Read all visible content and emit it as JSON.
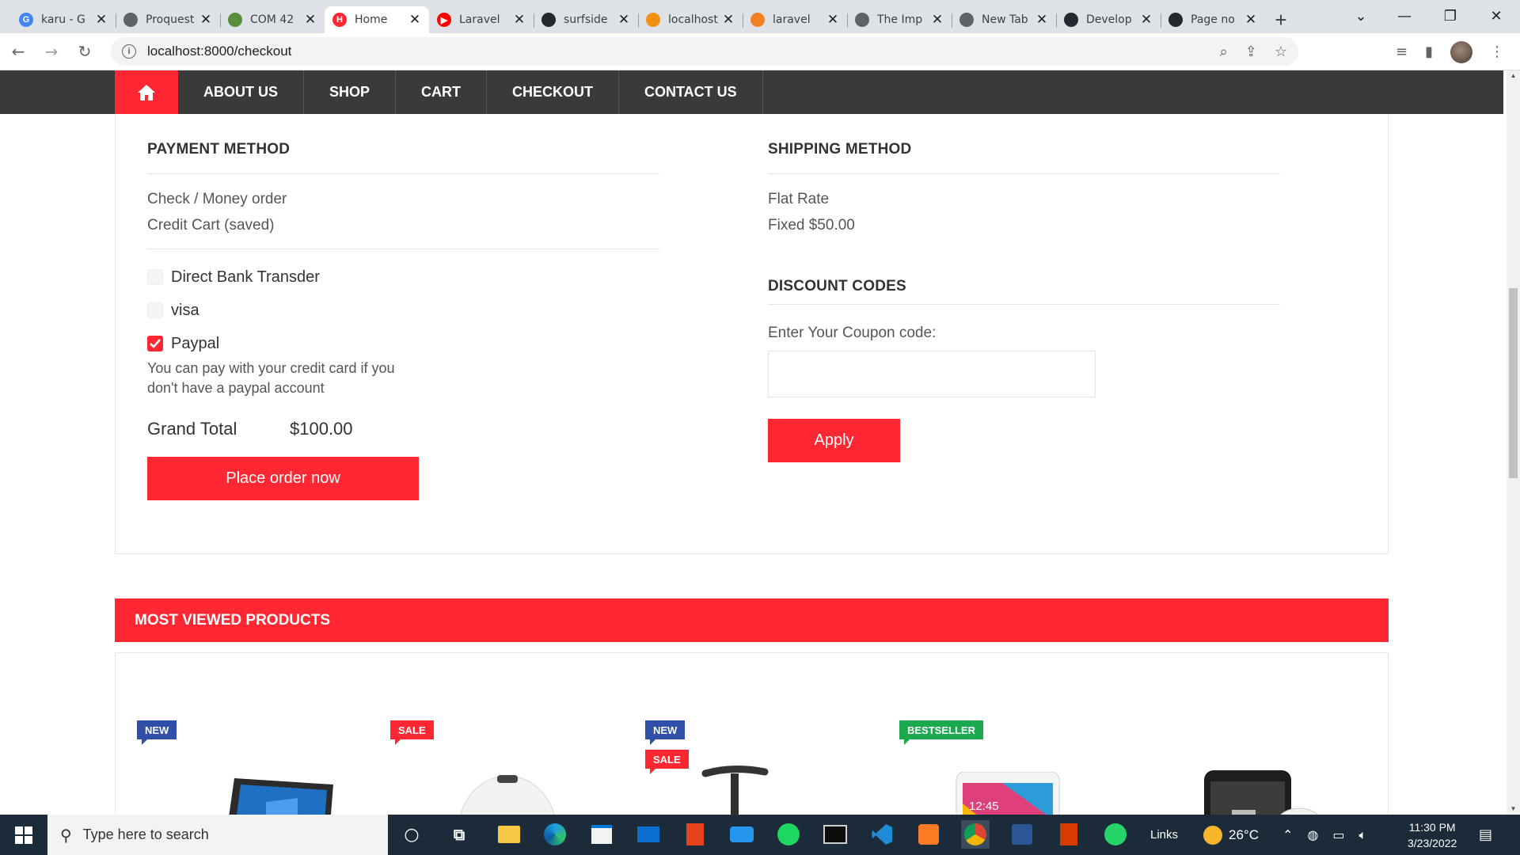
{
  "browser": {
    "tabs": [
      {
        "title": "karu - G",
        "fav_color": "#4285f4",
        "fav_glyph": "G",
        "active": false
      },
      {
        "title": "Proquest",
        "fav_color": "#5f6368",
        "fav_glyph": "",
        "active": false
      },
      {
        "title": "COM 42",
        "fav_color": "#5a8f3a",
        "fav_glyph": "",
        "active": false
      },
      {
        "title": "Home",
        "fav_color": "#ff2832",
        "fav_glyph": "H",
        "active": true
      },
      {
        "title": "Laravel",
        "fav_color": "#ff0000",
        "fav_glyph": "▶",
        "active": false
      },
      {
        "title": "surfside",
        "fav_color": "#24292f",
        "fav_glyph": "",
        "active": false
      },
      {
        "title": "localhost",
        "fav_color": "#f29111",
        "fav_glyph": "",
        "active": false
      },
      {
        "title": "laravel",
        "fav_color": "#f48024",
        "fav_glyph": "",
        "active": false
      },
      {
        "title": "The Imp",
        "fav_color": "#5f6368",
        "fav_glyph": "",
        "active": false
      },
      {
        "title": "New Tab",
        "fav_color": "#5f6368",
        "fav_glyph": "",
        "active": false
      },
      {
        "title": "Develop",
        "fav_color": "#24292f",
        "fav_glyph": "",
        "active": false
      },
      {
        "title": "Page no",
        "fav_color": "#24292f",
        "fav_glyph": "",
        "active": false
      }
    ],
    "url": "localhost:8000/checkout"
  },
  "site": {
    "accent_color": "#ff2832",
    "nav": {
      "links": [
        "ABOUT US",
        "SHOP",
        "CART",
        "CHECKOUT",
        "CONTACT US"
      ]
    },
    "payment": {
      "title": "PAYMENT METHOD",
      "methods_text": [
        "Check / Money order",
        "Credit Cart (saved)"
      ],
      "options": [
        {
          "label": "Direct Bank Transder",
          "checked": false
        },
        {
          "label": "visa",
          "checked": false
        },
        {
          "label": "Paypal",
          "checked": true
        }
      ],
      "paypal_note": "You can pay with your credit card if you don't have a paypal account",
      "grand_total_label": "Grand Total",
      "grand_total_value": "$100.00",
      "place_order_label": "Place order now"
    },
    "shipping": {
      "title": "SHIPPING METHOD",
      "lines": [
        "Flat Rate",
        "Fixed $50.00"
      ]
    },
    "discount": {
      "title": "DISCOUNT CODES",
      "coupon_label": "Enter Your Coupon code:",
      "coupon_value": "",
      "apply_label": "Apply"
    },
    "most_viewed": {
      "title": "MOST VIEWED PRODUCTS",
      "badges": [
        {
          "label": "NEW",
          "kind": "new"
        },
        {
          "label": "SALE",
          "kind": "sale"
        },
        {
          "label": "NEW",
          "kind": "new"
        },
        {
          "label": "SALE",
          "kind": "sale"
        },
        {
          "label": "BESTSELLER",
          "kind": "best"
        }
      ],
      "screen_time": "12:45"
    }
  },
  "taskbar": {
    "search_placeholder": "Type here to search",
    "links_label": "Links",
    "temperature": "26°C",
    "time": "11:30 PM",
    "date": "3/23/2022"
  }
}
